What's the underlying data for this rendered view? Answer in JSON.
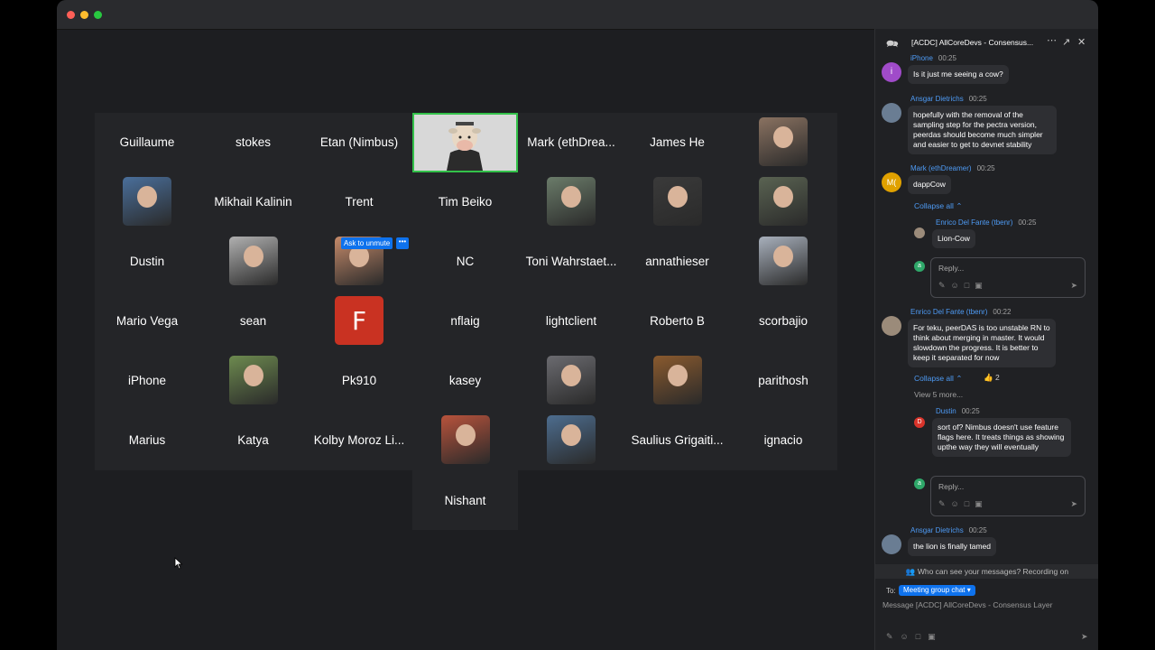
{
  "participants": [
    {
      "name": "Guillaume"
    },
    {
      "name": "stokes"
    },
    {
      "name": "Etan (Nimbus)"
    },
    {
      "name": "",
      "video": "cow"
    },
    {
      "name": "Mark (ethDrea..."
    },
    {
      "name": "James He"
    },
    {
      "name": "",
      "photo": "bearded-man"
    },
    {
      "name": "",
      "photo": "man-glasses"
    },
    {
      "name": "Mikhail Kalinin"
    },
    {
      "name": "Trent"
    },
    {
      "name": "Tim Beiko"
    },
    {
      "name": "",
      "photo": "man-outdoor"
    },
    {
      "name": "",
      "photo": "woman"
    },
    {
      "name": "",
      "photo": "man-dark"
    },
    {
      "name": "Dustin"
    },
    {
      "name": "",
      "photo": "man-grey"
    },
    {
      "name": "",
      "photo": "pixel-art"
    },
    {
      "name": "NC"
    },
    {
      "name": "Toni Wahrstaet..."
    },
    {
      "name": "annathieser"
    },
    {
      "name": "",
      "photo": "man-suit"
    },
    {
      "name": "Mario Vega"
    },
    {
      "name": "sean"
    },
    {
      "name": "",
      "letter": "F"
    },
    {
      "name": "nflaig"
    },
    {
      "name": "lightclient"
    },
    {
      "name": "Roberto B"
    },
    {
      "name": "scorbajio"
    },
    {
      "name": "iPhone"
    },
    {
      "name": "",
      "photo": "camera-man"
    },
    {
      "name": "Pk910"
    },
    {
      "name": "kasey"
    },
    {
      "name": "",
      "photo": "old-man"
    },
    {
      "name": "",
      "photo": "cowboy"
    },
    {
      "name": "parithosh"
    },
    {
      "name": "Marius"
    },
    {
      "name": "Katya"
    },
    {
      "name": "Kolby Moroz Li..."
    },
    {
      "name": "",
      "photo": "bench-man"
    },
    {
      "name": "",
      "photo": "smiling-man"
    },
    {
      "name": "Saulius Grigaiti..."
    },
    {
      "name": "ignacio"
    }
  ],
  "extra_participant": "Nishant",
  "unmute_label": "Ask to unmute",
  "more_label": "•••",
  "chat": {
    "title": "[ACDC] AllCoreDevs - Consensus...",
    "messages": [
      {
        "name": "iPhone",
        "time": "00:25",
        "text": "Is it just me seeing a cow?"
      },
      {
        "name": "Ansgar Dietrichs",
        "time": "00:25",
        "text": "hopefully with the removal of the sampling step for the pectra version, peerdas should become much simpler and easier to get to devnet stability"
      },
      {
        "name": "Mark (ethDreamer)",
        "time": "00:25",
        "text": "dappCow"
      },
      {
        "name": "Enrico Del Fante (tbenr)",
        "time": "00:25",
        "text": "Lion-Cow"
      },
      {
        "name": "Enrico Del Fante (tbenr)",
        "time": "00:22",
        "text": "For teku, peerDAS is too unstable RN to think about merging in master. It would slowdown the progress. It is better to keep it separated for now"
      },
      {
        "name": "Dustin",
        "time": "00:25",
        "text": "sort of? Nimbus doesn't use feature flags here. It treats things as showing upthe way they will eventually"
      },
      {
        "name": "Ansgar Dietrichs",
        "time": "00:25",
        "text": "the lion is finally tamed"
      }
    ],
    "collapse_label": "Collapse all",
    "view_more": "View 5 more...",
    "reaction_count": "2",
    "reply_placeholder": "Reply...",
    "avatar_letters": {
      "iphone": "i",
      "mark": "M(",
      "reply": "a",
      "dustin": "D"
    },
    "notice": "Who can see your messages? Recording on",
    "to_label": "To:",
    "to_target": "Meeting group chat ▾",
    "compose_placeholder": "Message [ACDC] AllCoreDevs - Consensus Layer"
  }
}
